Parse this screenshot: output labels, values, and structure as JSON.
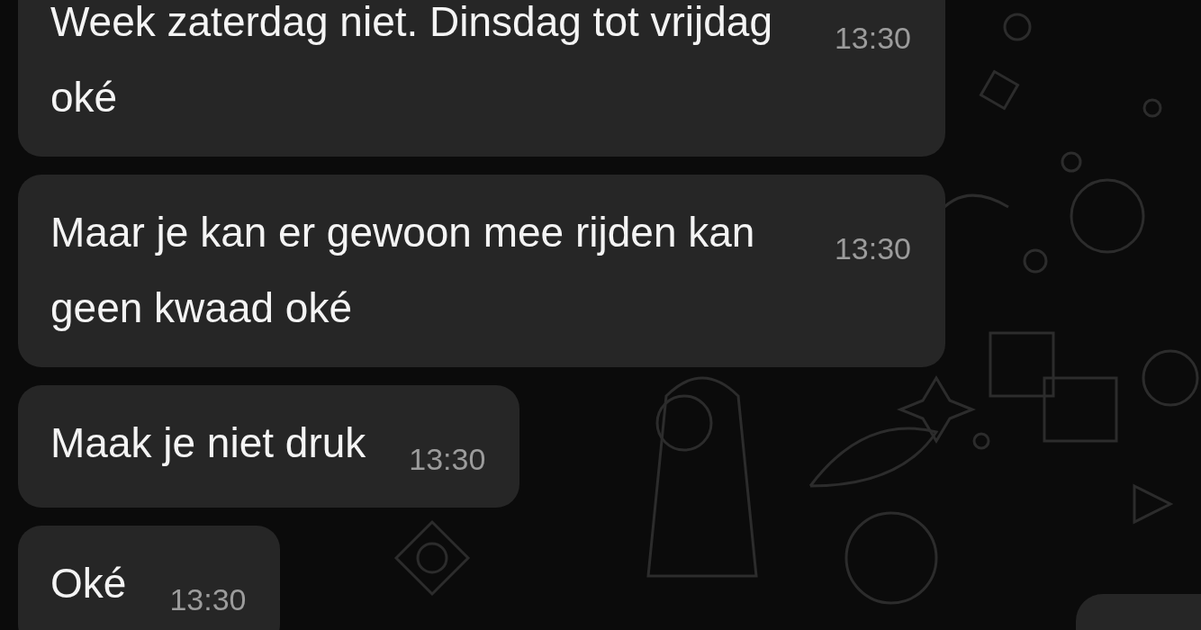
{
  "messages": [
    {
      "text": "Week zaterdag niet. Dinsdag tot vrijdag oké",
      "time": "13:30"
    },
    {
      "text": "Maar je kan er gewoon mee rijden kan geen kwaad oké",
      "time": "13:30"
    },
    {
      "text": "Maak je niet druk",
      "time": "13:30"
    },
    {
      "text": "Oké",
      "time": "13:30"
    }
  ]
}
